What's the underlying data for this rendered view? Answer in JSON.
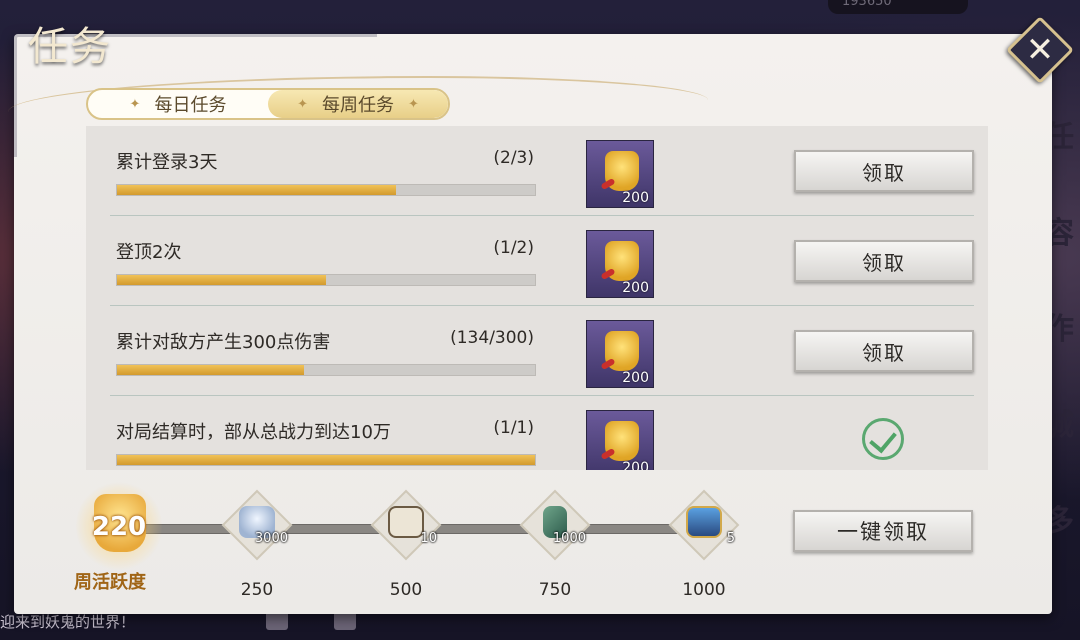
{
  "window": {
    "title": "任务"
  },
  "tabs": [
    {
      "label": "每日任务",
      "active": false
    },
    {
      "label": "每周任务",
      "active": true
    }
  ],
  "tasks": [
    {
      "name": "累计登录3天",
      "progress_text": "(2/3)",
      "progress": 0.667,
      "reward_icon": "gold-bag-icon",
      "reward_qty": "200",
      "claim_label": "领取",
      "completed": false
    },
    {
      "name": "登顶2次",
      "progress_text": "(1/2)",
      "progress": 0.5,
      "reward_icon": "gold-bag-icon",
      "reward_qty": "200",
      "claim_label": "领取",
      "completed": false
    },
    {
      "name": "累计对敌方产生300点伤害",
      "progress_text": "(134/300)",
      "progress": 0.447,
      "reward_icon": "gold-bag-icon",
      "reward_qty": "200",
      "claim_label": "领取",
      "completed": false
    },
    {
      "name": "对局结算时，部从总战力到达10万",
      "progress_text": "(1/1)",
      "progress": 1.0,
      "reward_icon": "gold-bag-icon",
      "reward_qty": "200",
      "claim_label": "",
      "completed": true
    }
  ],
  "activity": {
    "score": "220",
    "label": "周活跃度",
    "progress": 0.0,
    "milestones": [
      {
        "level": "250",
        "item_icon": "silver-ingot-icon",
        "qty": "3000"
      },
      {
        "level": "500",
        "item_icon": "dice-icon",
        "qty": "10"
      },
      {
        "level": "750",
        "item_icon": "jade-token-icon",
        "qty": "1000"
      },
      {
        "level": "1000",
        "item_icon": "treasure-chest-icon",
        "qty": "5"
      }
    ],
    "one_click_label": "一键领取"
  },
  "background": {
    "ticker": "迎来到妖鬼的世界！",
    "counter": "193650"
  },
  "colors": {
    "accent_gold": "#d29a2e",
    "panel_bg": "#f4f1ee",
    "check_green": "#4fa466",
    "reward_purple": "#4f4480"
  }
}
